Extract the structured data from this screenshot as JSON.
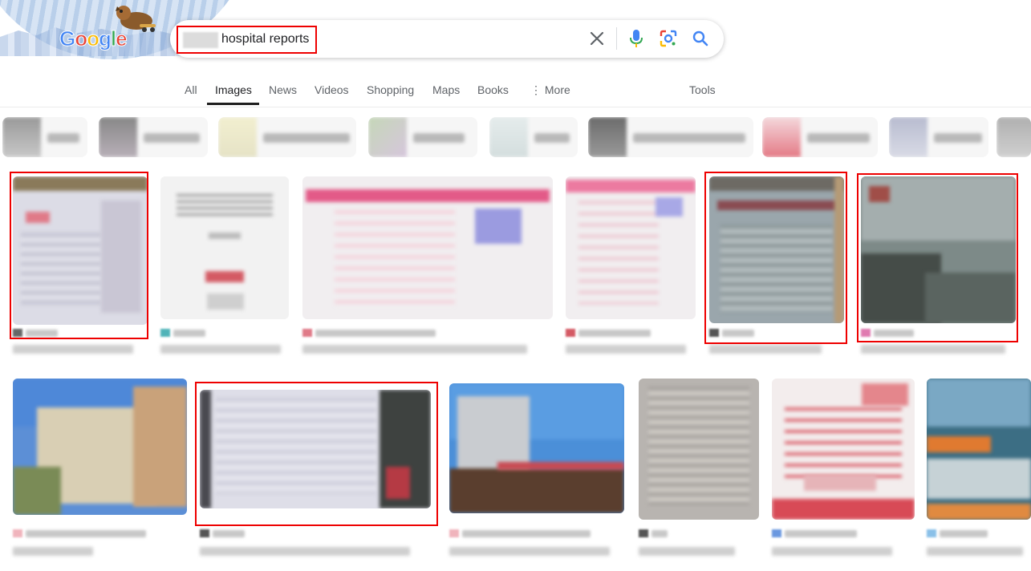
{
  "search": {
    "query": "hospital reports",
    "clear_icon": "close-icon",
    "voice_icon": "microphone-icon",
    "lens_icon": "camera-lens-icon",
    "search_icon": "search-icon"
  },
  "doodle": {
    "logo": [
      "G",
      "o",
      "o",
      "g",
      "l",
      "e"
    ]
  },
  "tabs": [
    {
      "label": "All"
    },
    {
      "label": "Images"
    },
    {
      "label": "News"
    },
    {
      "label": "Videos"
    },
    {
      "label": "Shopping"
    },
    {
      "label": "Maps"
    },
    {
      "label": "Books"
    },
    {
      "label": "⋮ More"
    }
  ],
  "tools_label": "Tools",
  "colors": {
    "highlight": "#ee0000",
    "accent_blue": "#4285f4",
    "text_gray": "#5f6368"
  }
}
